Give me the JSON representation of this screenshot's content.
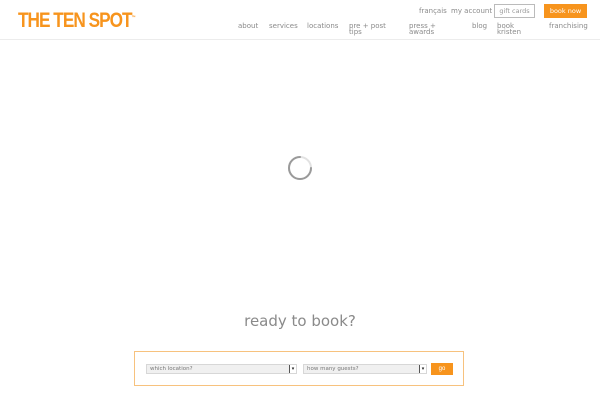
{
  "brand": {
    "logo_text": "THE TEN SPOT",
    "accent_color": "#f7941d"
  },
  "utility_nav": {
    "language": "français",
    "account": "my account",
    "gift_cards": "gift cards",
    "book_now": "book now"
  },
  "main_nav": [
    {
      "line1": "about",
      "line2": ""
    },
    {
      "line1": "services",
      "line2": ""
    },
    {
      "line1": "locations",
      "line2": ""
    },
    {
      "line1": "pre + post",
      "line2": "tips"
    },
    {
      "line1": "press +",
      "line2": "awards"
    },
    {
      "line1": "blog",
      "line2": ""
    },
    {
      "line1": "book",
      "line2": "kristen"
    },
    {
      "line1": "franchising",
      "line2": ""
    }
  ],
  "loading": {
    "icon": "spinner-icon"
  },
  "booking": {
    "heading": "ready to book?",
    "location_select": "which location?",
    "guests_select": "how many guests?",
    "go_label": "go"
  }
}
